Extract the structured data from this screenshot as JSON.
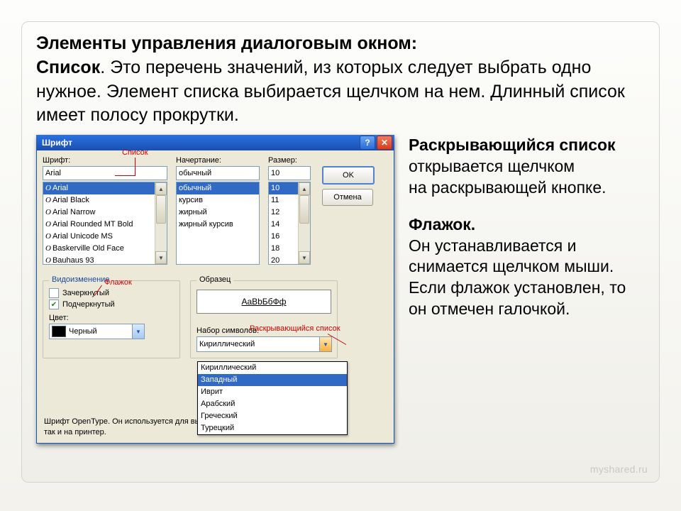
{
  "headline_bold1": "Элементы управления диалоговым окном:",
  "headline_bold2": "Список",
  "headline_rest": ". Это перечень значений, из которых следует выбрать одно нужное. Элемент списка выбирается щелчком на нем. Длинный список имеет полосу прокрутки.",
  "right": {
    "p1a": "Раскрывающийся список ",
    "p1b": "открывается щелчком",
    "p1c": " на раскрывающей кнопке.",
    "p2a": "Флажок.",
    "p2b": "Он устанавливается и снимается щелчком мыши. Если флажок установлен, то он отмечен галочкой."
  },
  "dlg": {
    "title": "Шрифт",
    "labels": {
      "font": "Шрифт:",
      "style": "Начертание:",
      "size": "Размер:",
      "color": "Цвет:",
      "charset": "Набор символов:"
    },
    "font_value": "Arial",
    "style_value": "обычный",
    "size_value": "10",
    "fonts": [
      "Arial",
      "Arial Black",
      "Arial Narrow",
      "Arial Rounded MT Bold",
      "Arial Unicode MS",
      "Baskerville Old Face",
      "Bauhaus 93"
    ],
    "styles": [
      "обычный",
      "курсив",
      "жирный",
      "жирный курсив"
    ],
    "sizes": [
      "10",
      "11",
      "12",
      "14",
      "16",
      "18",
      "20"
    ],
    "ok": "OK",
    "cancel": "Отмена",
    "grp_effects": "Видоизменение",
    "grp_sample": "Образец",
    "strike": "Зачеркнутый",
    "underline": "Подчеркнутый",
    "sample_text": "AaBbБбФф",
    "color_value": "Черный",
    "charset_value": "Кириллический",
    "charsets": [
      "Кириллический",
      "Западный",
      "Иврит",
      "Арабский",
      "Греческий",
      "Турецкий"
    ],
    "footer": "Шрифт OpenType. Он используется для вывода как на экран, так и на принтер."
  },
  "callouts": {
    "list": "Список",
    "checkbox": "Флажок",
    "dropdown": "Раскрывающийся список"
  },
  "watermark": "myshared.ru"
}
